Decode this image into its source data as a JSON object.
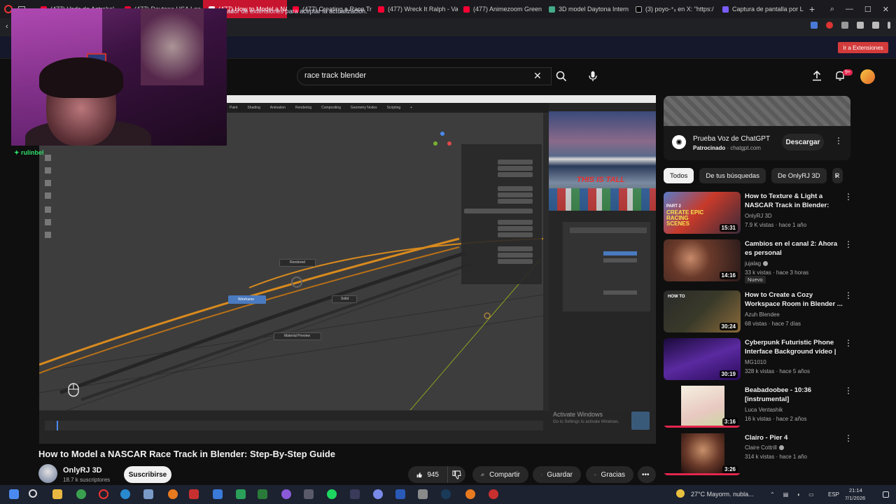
{
  "browser": {
    "tabs": [
      {
        "label": "(477) Vods de Astrobel",
        "icon": "youtube-icon",
        "active": false
      },
      {
        "label": "(477) Daytona USA Lon",
        "icon": "youtube-icon",
        "active": false
      },
      {
        "label": "(477) How to Model a NAS",
        "icon": "youtube-icon",
        "active": true
      },
      {
        "label": "(477) Creating a Race Tr",
        "icon": "youtube-icon",
        "active": false
      },
      {
        "label": "(477) Wreck It Ralph - Va",
        "icon": "youtube-icon",
        "active": false
      },
      {
        "label": "(477) Animezoom Green",
        "icon": "youtube-icon",
        "active": false
      },
      {
        "label": "3D model Daytona Intern",
        "icon": "web-icon",
        "active": false
      },
      {
        "label": "(3) poyo-⁺ₓ en X: \"https:/",
        "icon": "x-icon",
        "active": false
      },
      {
        "label": "Captura de pantalla por L",
        "icon": "capture-icon",
        "active": false
      }
    ],
    "notice": "ador de extensiones para aceptar la actualización.",
    "notice_button": "Ir a Extensiones"
  },
  "header": {
    "search_query": "race track blender",
    "notifications_badge": "9+"
  },
  "webcam": {
    "username": "rulinbel"
  },
  "player": {
    "blender_menu": [
      "Paint",
      "Shading",
      "Animation",
      "Rendering",
      "Compositing",
      "Geometry Nodes",
      "Scripting",
      "+"
    ],
    "photo_sign": "THIS IS TALL",
    "nodes": {
      "wireframe": "Wireframe",
      "rendered": "Rendered",
      "material": "Material Preview",
      "solid": "Solid"
    },
    "watermark_title": "Activate Windows",
    "watermark_sub": "Go to Settings to activate Windows."
  },
  "video": {
    "title": "How to Model a NASCAR Race Track in Blender: Step-By-Step Guide",
    "channel": "OnlyRJ 3D",
    "subscribers": "18.7 k suscriptores",
    "subscribe_label": "Suscribirse",
    "likes": "945",
    "share_label": "Compartir",
    "save_label": "Guardar",
    "thanks_label": "Gracias"
  },
  "sidebar": {
    "ad": {
      "title": "Prueba Voz de ChatGPT",
      "sponsored": "Patrocinado",
      "domain": "· chatgpt.com",
      "button": "Descargar"
    },
    "chips": [
      "Todos",
      "De tus búsquedas",
      "De OnlyRJ 3D",
      "R"
    ],
    "recommendations": [
      {
        "title": "How to Texture & Light a NASCAR Track in Blender: Ste...",
        "channel": "OnlyRJ 3D",
        "meta": "7.9 K vistas · hace 1 año",
        "duration": "15:31",
        "badge": "",
        "thumb_text": "CREATE EPIC RACING SCENES",
        "thumb_sub": "PART 2"
      },
      {
        "title": "Cambios en el canal 2: Ahora es personal",
        "channel": "jujalag",
        "meta": "33 k vistas · hace 3 horas",
        "duration": "14:16",
        "badge": "Nuevo",
        "thumb_text": "",
        "thumb_sub": ""
      },
      {
        "title": "How to Create a Cozy Workspace Room in Blender ...",
        "channel": "Azuh Blendee",
        "meta": "68 vistas · hace 7 días",
        "duration": "30:24",
        "badge": "",
        "thumb_text": "HOW TO",
        "thumb_sub": ""
      },
      {
        "title": "Cyberpunk Futuristic Phone Interface Background video | ...",
        "channel": "MG1010",
        "meta": "328 k vistas · hace 5 años",
        "duration": "30:19",
        "badge": "",
        "thumb_text": "",
        "thumb_sub": ""
      },
      {
        "title": "Beabadoobee - 10:36 [instrumental]",
        "channel": "Luca Ventashik",
        "meta": "16 k vistas · hace 2 años",
        "duration": "3:16",
        "badge": "",
        "thumb_text": "",
        "thumb_sub": ""
      },
      {
        "title": "Clairo - Pier 4",
        "channel": "Claire Cottrill",
        "meta": "314 k vistas · hace 1 año",
        "duration": "3:26",
        "badge": "",
        "thumb_text": "",
        "thumb_sub": ""
      }
    ]
  },
  "taskbar": {
    "weather": "27°C  Mayorm. nubla...",
    "lang": "ESP",
    "time": "21:14",
    "date": "7/1/2026"
  },
  "colors": {
    "accent_red": "#ff0033",
    "active_tab": "#c8152f",
    "background": "#0f0f0f"
  }
}
